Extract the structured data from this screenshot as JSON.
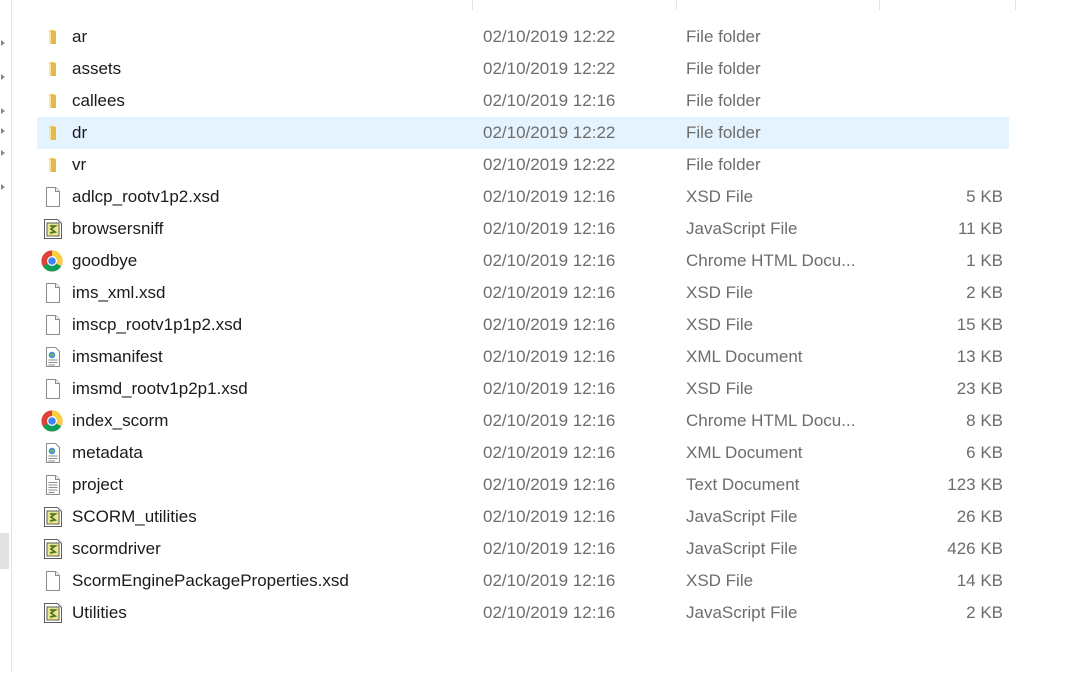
{
  "files": [
    {
      "name": "ar",
      "date": "02/10/2019 12:22",
      "type": "File folder",
      "size": "",
      "icon": "folder-icon"
    },
    {
      "name": "assets",
      "date": "02/10/2019 12:22",
      "type": "File folder",
      "size": "",
      "icon": "folder-icon"
    },
    {
      "name": "callees",
      "date": "02/10/2019 12:16",
      "type": "File folder",
      "size": "",
      "icon": "folder-icon"
    },
    {
      "name": "dr",
      "date": "02/10/2019 12:22",
      "type": "File folder",
      "size": "",
      "icon": "folder-icon",
      "selected": true
    },
    {
      "name": "vr",
      "date": "02/10/2019 12:22",
      "type": "File folder",
      "size": "",
      "icon": "folder-icon"
    },
    {
      "name": "adlcp_rootv1p2.xsd",
      "date": "02/10/2019 12:16",
      "type": "XSD File",
      "size": "5 KB",
      "icon": "blank-file-icon"
    },
    {
      "name": "browsersniff",
      "date": "02/10/2019 12:16",
      "type": "JavaScript File",
      "size": "11 KB",
      "icon": "javascript-file-icon"
    },
    {
      "name": "goodbye",
      "date": "02/10/2019 12:16",
      "type": "Chrome HTML Docu...",
      "size": "1 KB",
      "icon": "chrome-icon"
    },
    {
      "name": "ims_xml.xsd",
      "date": "02/10/2019 12:16",
      "type": "XSD File",
      "size": "2 KB",
      "icon": "blank-file-icon"
    },
    {
      "name": "imscp_rootv1p1p2.xsd",
      "date": "02/10/2019 12:16",
      "type": "XSD File",
      "size": "15 KB",
      "icon": "blank-file-icon"
    },
    {
      "name": "imsmanifest",
      "date": "02/10/2019 12:16",
      "type": "XML Document",
      "size": "13 KB",
      "icon": "xml-file-icon"
    },
    {
      "name": "imsmd_rootv1p2p1.xsd",
      "date": "02/10/2019 12:16",
      "type": "XSD File",
      "size": "23 KB",
      "icon": "blank-file-icon"
    },
    {
      "name": "index_scorm",
      "date": "02/10/2019 12:16",
      "type": "Chrome HTML Docu...",
      "size": "8 KB",
      "icon": "chrome-icon"
    },
    {
      "name": "metadata",
      "date": "02/10/2019 12:16",
      "type": "XML Document",
      "size": "6 KB",
      "icon": "xml-file-icon"
    },
    {
      "name": "project",
      "date": "02/10/2019 12:16",
      "type": "Text Document",
      "size": "123 KB",
      "icon": "text-file-icon"
    },
    {
      "name": "SCORM_utilities",
      "date": "02/10/2019 12:16",
      "type": "JavaScript File",
      "size": "26 KB",
      "icon": "javascript-file-icon"
    },
    {
      "name": "scormdriver",
      "date": "02/10/2019 12:16",
      "type": "JavaScript File",
      "size": "426 KB",
      "icon": "javascript-file-icon"
    },
    {
      "name": "ScormEnginePackageProperties.xsd",
      "date": "02/10/2019 12:16",
      "type": "XSD File",
      "size": "14 KB",
      "icon": "blank-file-icon"
    },
    {
      "name": "Utilities",
      "date": "02/10/2019 12:16",
      "type": "JavaScript File",
      "size": "2 KB",
      "icon": "javascript-file-icon"
    }
  ],
  "colors": {
    "selected_row": "#e5f3ff",
    "folder": "#f8d775",
    "secondary_text": "#6d6d6d"
  }
}
